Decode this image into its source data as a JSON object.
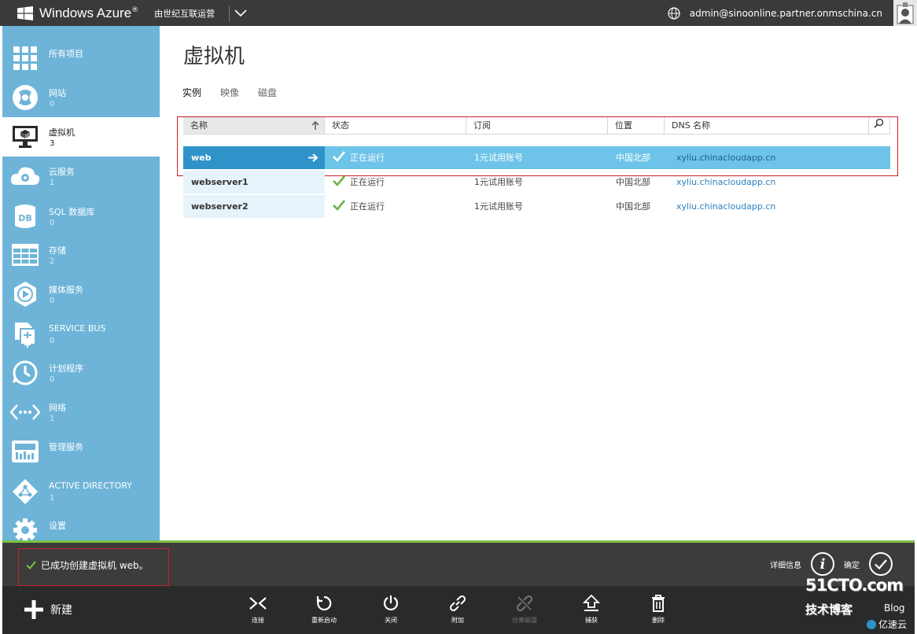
{
  "topbar": {
    "brand": "Windows Azure",
    "brand_mark": "®",
    "operator": "由世纪互联运营",
    "account": "admin@sinoonline.partner.onmschina.cn"
  },
  "sidebar": {
    "items": [
      {
        "label": "所有项目",
        "count": "",
        "icon": "grid-icon"
      },
      {
        "label": "网站",
        "count": "0",
        "icon": "globe-icon"
      },
      {
        "label": "虚拟机",
        "count": "3",
        "icon": "monitor-icon"
      },
      {
        "label": "云服务",
        "count": "1",
        "icon": "cloud-gear-icon"
      },
      {
        "label": "SQL 数据库",
        "count": "0",
        "icon": "database-icon"
      },
      {
        "label": "存储",
        "count": "2",
        "icon": "table-icon"
      },
      {
        "label": "媒体服务",
        "count": "0",
        "icon": "media-icon"
      },
      {
        "label": "SERVICE BUS",
        "count": "0",
        "icon": "service-bus-icon"
      },
      {
        "label": "计划程序",
        "count": "0",
        "icon": "clock-icon"
      },
      {
        "label": "网络",
        "count": "1",
        "icon": "network-icon"
      },
      {
        "label": "管理服务",
        "count": "",
        "icon": "management-icon"
      },
      {
        "label": "ACTIVE DIRECTORY",
        "count": "1",
        "icon": "directory-icon"
      },
      {
        "label": "设置",
        "count": "",
        "icon": "settings-icon"
      }
    ]
  },
  "main": {
    "title": "虚拟机",
    "tabs": [
      "实例",
      "映像",
      "磁盘"
    ],
    "columns": [
      "名称",
      "状态",
      "订阅",
      "位置",
      "DNS 名称"
    ],
    "rows": [
      {
        "name": "web",
        "status": "正在运行",
        "subscription": "1元试用账号",
        "location": "中国北部",
        "dns": "xyliu.chinacloudapp.cn"
      },
      {
        "name": "webserver1",
        "status": "正在运行",
        "subscription": "1元试用账号",
        "location": "中国北部",
        "dns": "xyliu.chinacloudapp.cn"
      },
      {
        "name": "webserver2",
        "status": "正在运行",
        "subscription": "1元试用账号",
        "location": "中国北部",
        "dns": "xyliu.chinacloudapp.cn"
      }
    ]
  },
  "notice": {
    "message": "已成功创建虚拟机 web。",
    "details_label": "详细信息",
    "ok_label": "确定"
  },
  "toolbar": {
    "new_label": "新建",
    "actions": [
      {
        "label": "连接",
        "icon": "connect-icon",
        "enabled": true
      },
      {
        "label": "重新启动",
        "icon": "restart-icon",
        "enabled": true
      },
      {
        "label": "关闭",
        "icon": "power-icon",
        "enabled": true
      },
      {
        "label": "附加",
        "icon": "attach-icon",
        "enabled": true
      },
      {
        "label": "分离磁盘",
        "icon": "detach-icon",
        "enabled": false
      },
      {
        "label": "捕获",
        "icon": "capture-icon",
        "enabled": true
      },
      {
        "label": "删除",
        "icon": "delete-icon",
        "enabled": true
      }
    ]
  },
  "watermark": {
    "site": "51CTO.com",
    "tagline": "技术博客",
    "blog": "Blog",
    "partner": "亿速云"
  },
  "colors": {
    "sidebar": "#6eb4d8",
    "selected_row": "#6ec4e8",
    "selected_name": "#2f93c9",
    "accent_green": "#7bc242",
    "highlight_border": "#c8202a"
  }
}
